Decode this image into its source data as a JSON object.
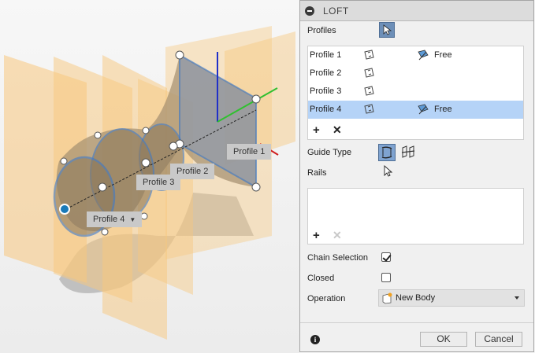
{
  "viewport": {
    "labels": {
      "profile1": "Profile 1",
      "profile2": "Profile 2",
      "profile3": "Profile 3",
      "profile4": "Profile 4"
    }
  },
  "dialog": {
    "title": "LOFT",
    "profiles_label": "Profiles",
    "profile_rows": [
      {
        "name": "Profile 1",
        "condition": "Free"
      },
      {
        "name": "Profile 2",
        "condition": ""
      },
      {
        "name": "Profile 3",
        "condition": ""
      },
      {
        "name": "Profile 4",
        "condition": "Free"
      }
    ],
    "selected_row": "Profile 4",
    "guide_type_label": "Guide Type",
    "rails_label": "Rails",
    "chain_selection_label": "Chain Selection",
    "chain_selection_checked": true,
    "closed_label": "Closed",
    "closed_checked": false,
    "operation_label": "Operation",
    "operation_value": "New Body",
    "ok_label": "OK",
    "cancel_label": "Cancel"
  },
  "colors": {
    "selected_row": "#b5d3f7",
    "select_button": "#6d8fb8",
    "sketch_plane": "#f7c77e",
    "sketch_edge": "#3c78c8"
  },
  "icons": [
    "collapse-icon",
    "pointer-icon",
    "profile-icon",
    "free-condition-icon",
    "add-icon",
    "remove-icon",
    "guide-rails-icon",
    "guide-centerline-icon",
    "cursor-icon",
    "new-body-icon",
    "info-icon"
  ]
}
